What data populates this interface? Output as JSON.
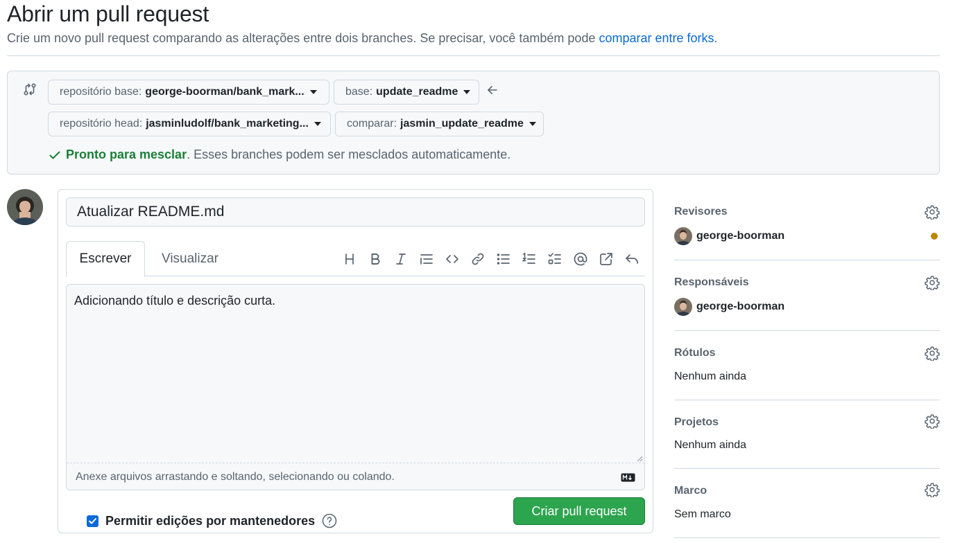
{
  "header": {
    "title": "Abrir um pull request",
    "subtitle_prefix": "Crie um novo pull request comparando as alterações entre dois branches. Se precisar, você também pode ",
    "subtitle_link": "comparar entre forks",
    "subtitle_suffix": "."
  },
  "compare": {
    "base_repo_label": "repositório base:",
    "base_repo_value": "george-boorman/bank_mark...",
    "base_branch_label": "base:",
    "base_branch_value": "update_readme",
    "head_repo_label": "repositório head:",
    "head_repo_value": "jasminludolf/bank_marketing...",
    "compare_label": "comparar:",
    "compare_value": "jasmin_update_readme",
    "merge_ok": "Pronto para mesclar",
    "merge_rest": ". Esses branches podem ser mesclados automaticamente."
  },
  "form": {
    "title_value": "Atualizar README.md",
    "tabs": [
      "Escrever",
      "Visualizar"
    ],
    "body_value": "Adicionando título e descrição curta.",
    "attach_hint": "Anexe arquivos arrastando e soltando, selecionando ou colando.",
    "allow_edits_label": "Permitir edições por mantenedores",
    "allow_edits_checked": true,
    "create_button": "Criar pull request",
    "toolbar_icons": [
      "heading-icon",
      "bold-icon",
      "italic-icon",
      "quote-icon",
      "code-icon",
      "link-icon",
      "unordered-list-icon",
      "ordered-list-icon",
      "task-list-icon",
      "mention-icon",
      "cross-reference-icon",
      "reply-icon"
    ]
  },
  "sidebar": {
    "reviewers": {
      "heading": "Revisores",
      "user": "george-boorman",
      "status_color": "#bf8700"
    },
    "assignees": {
      "heading": "Responsáveis",
      "user": "george-boorman"
    },
    "labels": {
      "heading": "Rótulos",
      "value": "Nenhum ainda"
    },
    "projects": {
      "heading": "Projetos",
      "value": "Nenhum ainda"
    },
    "milestone": {
      "heading": "Marco",
      "value": "Sem marco"
    }
  },
  "colors": {
    "success": "#1a7f37",
    "primary_button": "#2da44e",
    "link": "#0969da",
    "pending": "#bf8700"
  }
}
